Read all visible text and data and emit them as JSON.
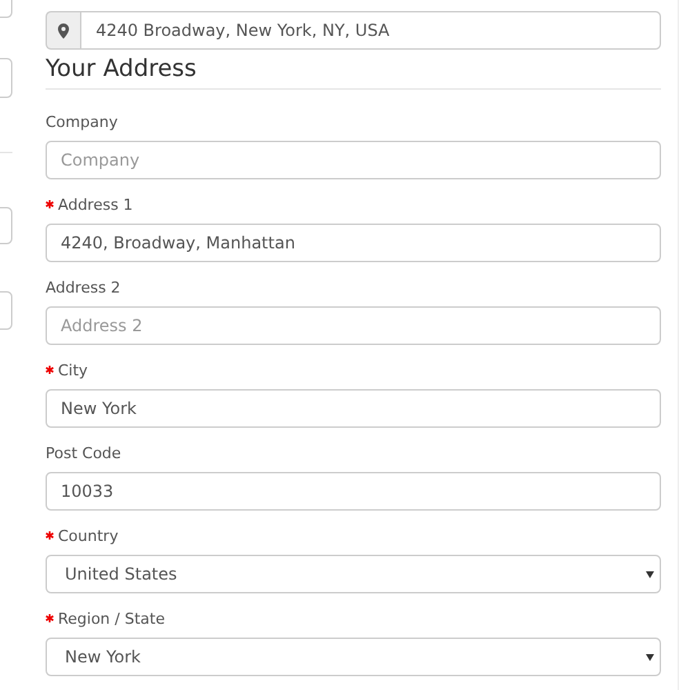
{
  "location_search": {
    "value": "4240 Broadway, New York, NY, USA"
  },
  "heading": "Your Address",
  "fields": [
    {
      "kind": "text",
      "label": "Company",
      "required": false,
      "placeholder": "Company"
    },
    {
      "kind": "text",
      "label": "Address 1",
      "required": true,
      "value": "4240, Broadway, Manhattan"
    },
    {
      "kind": "text",
      "label": "Address 2",
      "required": false,
      "placeholder": "Address 2"
    },
    {
      "kind": "text",
      "label": "City",
      "required": true,
      "value": "New York"
    },
    {
      "kind": "text",
      "label": "Post Code",
      "required": false,
      "value": "10033"
    },
    {
      "kind": "select",
      "label": "Country",
      "required": true,
      "value": "United States"
    },
    {
      "kind": "select",
      "label": "Region / State",
      "required": true,
      "value": "New York"
    }
  ]
}
